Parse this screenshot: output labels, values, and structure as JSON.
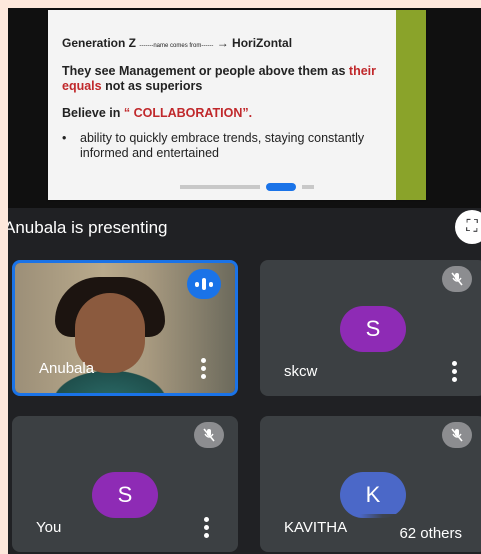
{
  "slide": {
    "generation": "Generation Z",
    "name_comes_from": "-------name comes from------",
    "horizontal": "HoriZontal",
    "mgmt_part1": "They see Management or people above them as ",
    "mgmt_red": "their equals",
    "mgmt_part2": " not as superiors",
    "believe_part1": "Believe in ",
    "believe_red": "“ COLLABORATION”.",
    "bullet_text": "ability to quickly embrace trends, staying constantly informed and entertained"
  },
  "presenting": {
    "text": "Anubala is presenting"
  },
  "participants": [
    {
      "name": "Anubala",
      "speaking": true
    },
    {
      "name": "skcw",
      "initial": "S",
      "avatar_color": "#8e2bb5",
      "muted": true
    },
    {
      "name": "You",
      "initial": "S",
      "avatar_color": "#8e2bb5",
      "muted": true
    },
    {
      "name": "KAVITHA",
      "initial": "K",
      "avatar_color": "#4b68c8",
      "muted": true
    }
  ],
  "others_label": "62 others",
  "colors": {
    "accent": "#1a73e8",
    "muted_badge": "#8c8d90",
    "tile_bg": "#3c4043"
  }
}
